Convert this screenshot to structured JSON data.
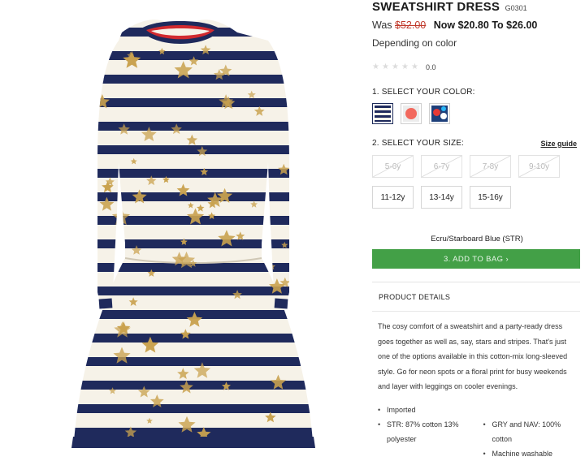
{
  "product": {
    "title": "SWEATSHIRT DRESS",
    "sku": "G0301",
    "was_label": "Was",
    "was_price": "$52.00",
    "now_price": "Now $20.80 To $26.00",
    "price_note": "Depending on color",
    "rating_value": "0.0",
    "rating_stars": 0,
    "image_alt": "Sweatshirt dress with navy stripes and gold stars"
  },
  "color": {
    "label": "1. SELECT YOUR COLOR:",
    "swatches": [
      {
        "name": "navy-stripe",
        "selected": true
      },
      {
        "name": "coral-spot",
        "selected": false
      },
      {
        "name": "floral-print",
        "selected": false
      }
    ],
    "selected_name": "Ecru/Starboard Blue (STR)"
  },
  "size": {
    "label": "2. SELECT YOUR SIZE:",
    "guide_link": "Size guide",
    "options": [
      {
        "label": "5-6y",
        "available": false
      },
      {
        "label": "6-7y",
        "available": false
      },
      {
        "label": "7-8y",
        "available": false
      },
      {
        "label": "9-10y",
        "available": false
      },
      {
        "label": "11-12y",
        "available": true
      },
      {
        "label": "13-14y",
        "available": true
      },
      {
        "label": "15-16y",
        "available": true
      }
    ]
  },
  "cart": {
    "add_label": "3. ADD TO BAG",
    "add_arrow": "›",
    "button_color": "#43a047"
  },
  "details": {
    "header": "PRODUCT DETAILS",
    "description": "The cosy comfort of a sweatshirt and a party-ready dress goes together as well as, say, stars and stripes. That's just one of the options available in this cotton-mix long-sleeved style. Go for neon spots or a floral print for busy weekends and layer with leggings on cooler evenings.",
    "bullets": {
      "imported": "Imported",
      "str": "STR: 87% cotton 13% polyester",
      "gry": "GRY and NAV: 100% cotton",
      "wash": "Machine washable"
    }
  },
  "colors": {
    "navy": "#1f2a5c",
    "gold": "#c9a24f",
    "ecru": "#f6f2e8",
    "collar_red": "#d12a2f",
    "price_red": "#c0392b"
  }
}
